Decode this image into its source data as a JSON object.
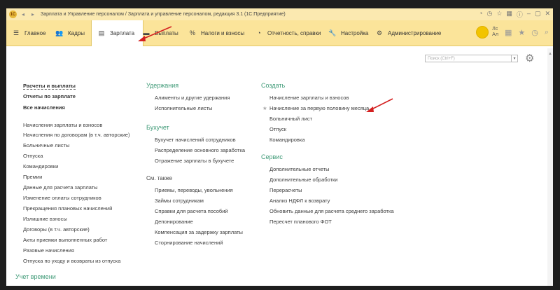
{
  "window": {
    "title": "Зарплата и Управление персоналом / Зарплата и управление персоналом, редакция 3.1 (1С:Предприятие)"
  },
  "menu": [
    {
      "label": "Главное",
      "icon": "menu-lines-icon"
    },
    {
      "label": "Кадры",
      "icon": "people-icon"
    },
    {
      "label": "Зарплата",
      "icon": "document-icon",
      "active": true
    },
    {
      "label": "Выплаты",
      "icon": "wallet-icon"
    },
    {
      "label": "Налоги и взносы",
      "icon": "percent-icon"
    },
    {
      "label": "Отчетность, справки",
      "icon": "chart-icon"
    },
    {
      "label": "Настройка",
      "icon": "wrench-icon"
    },
    {
      "label": "Администрирование",
      "icon": "gear-icon"
    }
  ],
  "user": {
    "line1": "Лс",
    "line2": "Ал"
  },
  "search": {
    "placeholder": "Поиск (Ctrl+F)"
  },
  "left": {
    "top": [
      "Расчеты и выплаты",
      "Отчеты по зарплате",
      "Все начисления"
    ],
    "items": [
      "Начисления зарплаты и взносов",
      "Начисления по договорам (в т.ч. авторские)",
      "Больничные листы",
      "Отпуска",
      "Командировки",
      "Премии",
      "Данные для расчета зарплаты",
      "Изменение оплаты сотрудников",
      "Прекращения плановых начислений",
      "Излишние взносы",
      "Договоры (в т.ч. авторские)",
      "Акты приемки выполненных работ",
      "Разовые начисления",
      "Отпуска по уходу и возвраты из отпуска"
    ],
    "bottom_head": "Учет времени"
  },
  "middle": {
    "sec1_head": "Удержания",
    "sec1": [
      "Алименты и другие удержания",
      "Исполнительные листы"
    ],
    "sec2_head": "Бухучет",
    "sec2": [
      "Бухучет начислений сотрудников",
      "Распределение основного заработка",
      "Отражение зарплаты в бухучете"
    ],
    "sec3_head": "См. также",
    "sec3": [
      "Приемы, переводы, увольнения",
      "Займы сотрудникам",
      "Справки для расчета пособий",
      "Депонирование",
      "Компенсация за задержку зарплаты",
      "Сторнирование начислений"
    ]
  },
  "right": {
    "sec1_head": "Создать",
    "sec1": [
      "Начисление зарплаты и взносов",
      "Начисление за первую половину месяца",
      "Больничный лист",
      "Отпуск",
      "Командировка"
    ],
    "sec2_head": "Сервис",
    "sec2": [
      "Дополнительные отчеты",
      "Дополнительные обработки",
      "Перерасчеты",
      "Анализ НДФЛ к возврату",
      "Обновить данные для расчета среднего заработка",
      "Пересчет планового ФОТ"
    ]
  },
  "colors": {
    "accent": "#3f9a77",
    "menubar": "#fbe49a",
    "arrow": "#d42020"
  }
}
